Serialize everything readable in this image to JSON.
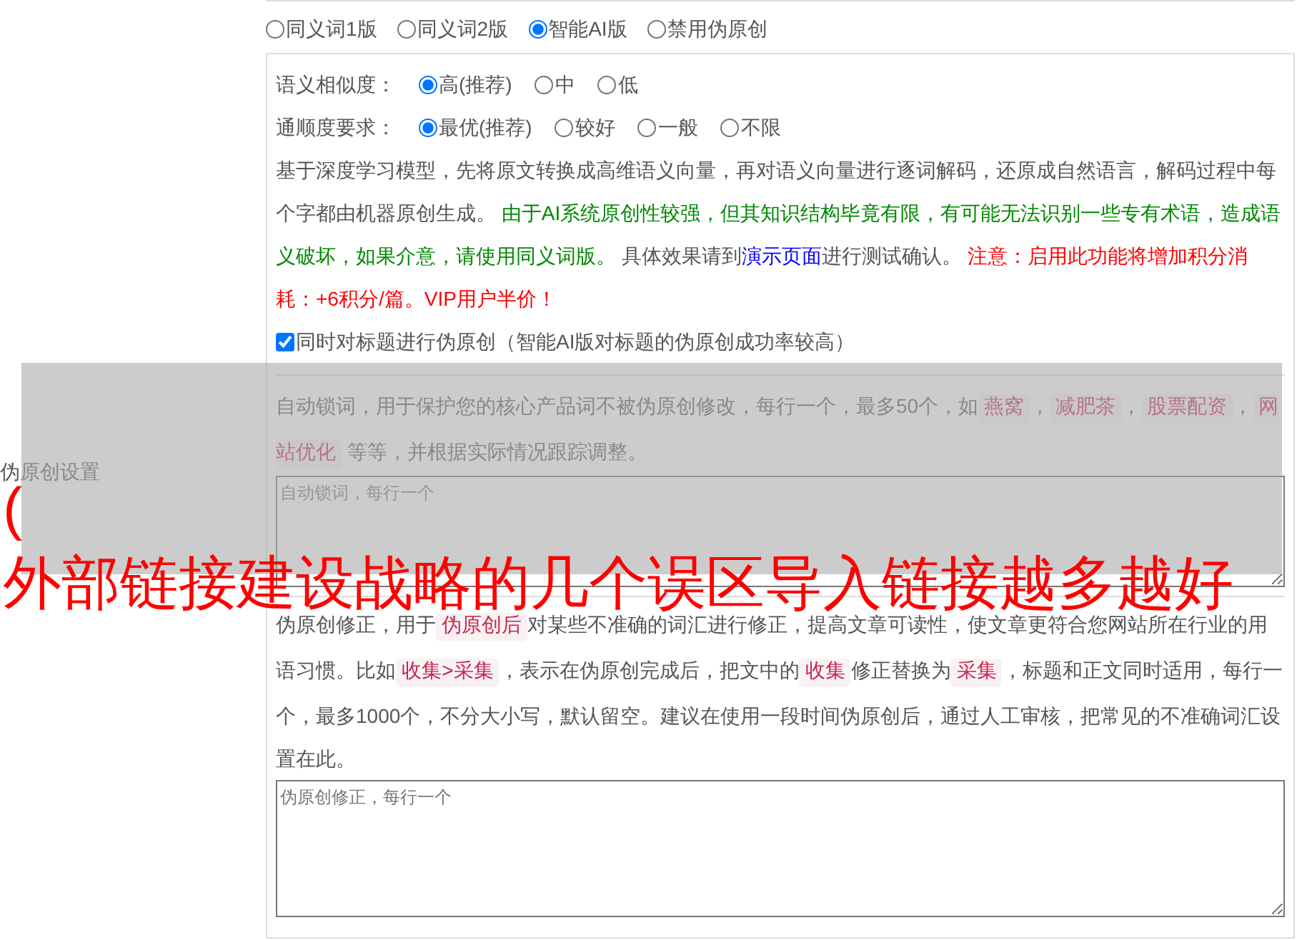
{
  "side_label": "伪原创设置",
  "modes": [
    {
      "label": "同义词1版",
      "selected": false
    },
    {
      "label": "同义词2版",
      "selected": false
    },
    {
      "label": "智能AI版",
      "selected": true
    },
    {
      "label": "禁用伪原创",
      "selected": false
    }
  ],
  "similarity": {
    "label": "语义相似度：",
    "options": [
      {
        "label": "高(推荐)",
        "selected": true
      },
      {
        "label": "中",
        "selected": false
      },
      {
        "label": "低",
        "selected": false
      }
    ]
  },
  "fluency": {
    "label": "通顺度要求：",
    "options": [
      {
        "label": "最优(推荐)",
        "selected": true
      },
      {
        "label": "较好",
        "selected": false
      },
      {
        "label": "一般",
        "selected": false
      },
      {
        "label": "不限",
        "selected": false
      }
    ]
  },
  "description": [
    {
      "kind": "plain",
      "text": "基于深度学习模型，先将原文转换成高维语义向量，再对语义向量进行逐词解码，还原成自然语言，解码过程中每个字都由机器原创生成。 "
    },
    {
      "kind": "green",
      "text": "由于AI系统原创性较强，但其知识结构毕竟有限，有可能无法识别一些专有术语，造成语义破坏，如果介意，请使用同义词版。"
    },
    {
      "kind": "plain",
      "text": " 具体效果请到"
    },
    {
      "kind": "link",
      "text": "演示页面"
    },
    {
      "kind": "plain",
      "text": "进行测试确认。 "
    },
    {
      "kind": "warning",
      "text": "注意：启用此功能将增加积分消耗：+6积分/篇。VIP用户半价！"
    }
  ],
  "title_option": {
    "label": "同时对标题进行伪原创（智能AI版对标题的伪原创成功率较高）",
    "checked": true
  },
  "lock_words": {
    "description": [
      {
        "kind": "plain",
        "text": "自动锁词，用于保护您的核心产品词不被伪原创修改，每行一个，最多50个，如"
      },
      {
        "kind": "code",
        "text": "燕窝"
      },
      {
        "kind": "plain",
        "text": "，"
      },
      {
        "kind": "code",
        "text": "减肥茶"
      },
      {
        "kind": "plain",
        "text": "，"
      },
      {
        "kind": "code",
        "text": "股票配资"
      },
      {
        "kind": "plain",
        "text": "，"
      },
      {
        "kind": "code",
        "text": "网站优化"
      },
      {
        "kind": "plain",
        "text": " 等等，并根据实际情况跟踪调整。"
      }
    ],
    "placeholder": "自动锁词，每行一个"
  },
  "corrections": {
    "description": [
      {
        "kind": "plain",
        "text": "伪原创修正，用于"
      },
      {
        "kind": "code",
        "text": "伪原创后"
      },
      {
        "kind": "plain",
        "text": "对某些不准确的词汇进行修正，提高文章可读性，使文章更符合您网站所在行业的用语习惯。比如"
      },
      {
        "kind": "code",
        "text": "收集>采集"
      },
      {
        "kind": "plain",
        "text": "，表示在伪原创完成后，把文中的"
      },
      {
        "kind": "code",
        "text": "收集"
      },
      {
        "kind": "plain",
        "text": "修正替换为"
      },
      {
        "kind": "code",
        "text": "采集"
      },
      {
        "kind": "plain",
        "text": "，标题和正文同时适用，每行一个，最多1000个，不分大小写，默认留空。建议在使用一段时间伪原创后，通过人工审核，把常见的不准确词汇设置在此。"
      }
    ],
    "placeholder": "伪原创修正，每行一个"
  },
  "overlay": {
    "lines": [
      "(",
      "外部链接建设战略的几个误区导入链接越多越好"
    ]
  }
}
